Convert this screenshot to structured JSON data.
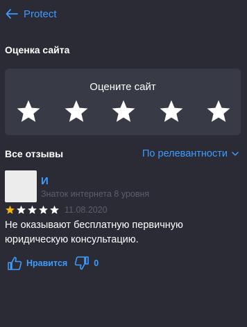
{
  "header": {
    "back_label": "Protect",
    "back_icon": "arrow-left-icon"
  },
  "rating_section": {
    "title": "Оценка сайта",
    "prompt": "Оцените сайт",
    "star_count": 5
  },
  "reviews": {
    "title": "Все отзывы",
    "sort_label": "По релевантности",
    "items": [
      {
        "author": "И",
        "author_level": "Знаток интернета 8 уровня",
        "rating": 1,
        "max_rating": 5,
        "date": "11.08.2020",
        "text": "Не оказывают бесплатную первичную юридическую консультацию.",
        "like_label": "Нравится",
        "dislike_count": "0"
      }
    ]
  },
  "colors": {
    "background": "#2a2b35",
    "card": "#383a45",
    "accent": "#3f9bff",
    "star_filled": "#f5b800",
    "muted": "#5c5e6a"
  }
}
